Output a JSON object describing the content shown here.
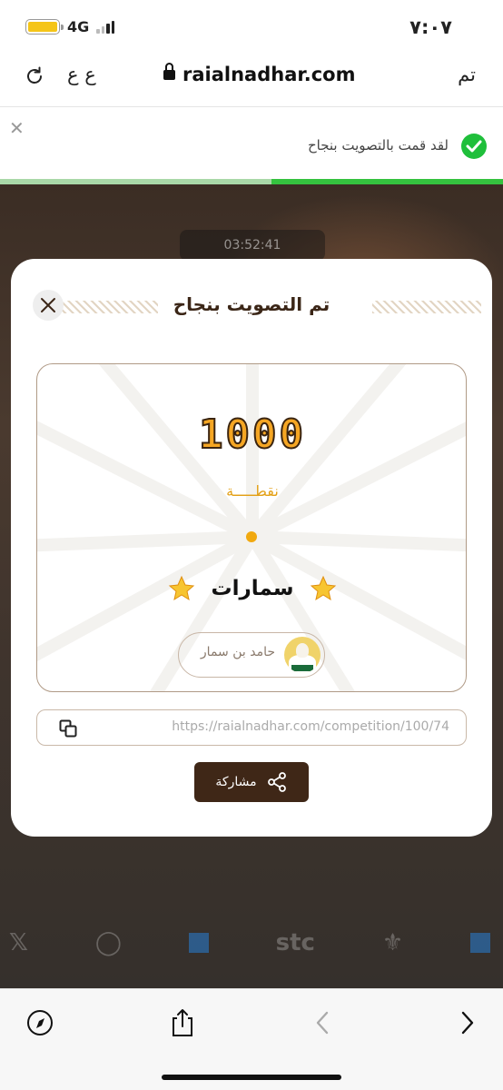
{
  "status_bar": {
    "time": "٧:٠٧",
    "network": "4G",
    "battery_color": "#f5c518"
  },
  "browser": {
    "text_size_label": "ع ع",
    "url": "raialnadhar.com",
    "done_label": "تم",
    "reload_icon": "reload-icon",
    "lock_icon": "lock-icon"
  },
  "notification": {
    "message": "لقد قمت بالتصويت بنجاح",
    "close_symbol": "✕",
    "progress": 0.46,
    "accent": "#35c23f"
  },
  "background": {
    "timer": "03:52:41"
  },
  "modal": {
    "title": "تم التصويت بنجاح",
    "points": "1000",
    "points_label": "نقطـــــة",
    "participant_name": "سمارات",
    "owner_name": "حامد بن سمار",
    "link": "https://raialnadhar.com/competition/100/74",
    "share_label": "مشاركة",
    "brand_color": "#3f2717",
    "points_color": "#f5a623"
  },
  "toolbar": {
    "icons": [
      "compass-icon",
      "share-icon",
      "back-icon",
      "forward-icon"
    ]
  }
}
